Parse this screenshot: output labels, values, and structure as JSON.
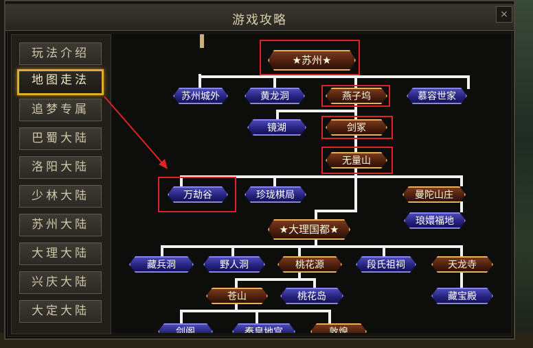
{
  "window": {
    "title": "游戏攻略",
    "close_label": "×"
  },
  "sidebar": {
    "items": [
      {
        "label": "玩法介绍",
        "active": false
      },
      {
        "label": "地图走法",
        "active": true
      },
      {
        "label": "追梦专属",
        "active": false
      },
      {
        "label": "巴蜀大陆",
        "active": false
      },
      {
        "label": "洛阳大陆",
        "active": false
      },
      {
        "label": "少林大陆",
        "active": false
      },
      {
        "label": "苏州大陆",
        "active": false
      },
      {
        "label": "大理大陆",
        "active": false
      },
      {
        "label": "兴庆大陆",
        "active": false
      },
      {
        "label": "大定大陆",
        "active": false
      }
    ]
  },
  "map": {
    "suzhou": "★苏州★",
    "suzhou_out": "苏州城外",
    "huanglong": "黄龙洞",
    "yanziwu": "燕子坞",
    "murong": "慕容世家",
    "jinghu": "镜湖",
    "jianzhong": "剑冢",
    "wuliang": "无量山",
    "wanjie": "万劫谷",
    "zhenlong": "珍珑棋局",
    "mantuo": "曼陀山庄",
    "langhuan": "琅嬛福地",
    "dali": "★大理国都★",
    "cangbing": "藏兵洞",
    "yeren": "野人洞",
    "taohuayuan": "桃花源",
    "duanshi": "段氏祖祠",
    "tianlong": "天龙寺",
    "cangshan": "苍山",
    "taohuadao": "桃花岛",
    "cangbao": "藏宝殿",
    "jiange": "剑阁",
    "qinhuang": "秦皇地宫",
    "dunhuang": "敦煌"
  },
  "colors": {
    "highlight_border": "#e02323",
    "active_menu_border": "#e2ad28",
    "blue_node": "#23207a",
    "orange_node": "#4a1e0e"
  }
}
